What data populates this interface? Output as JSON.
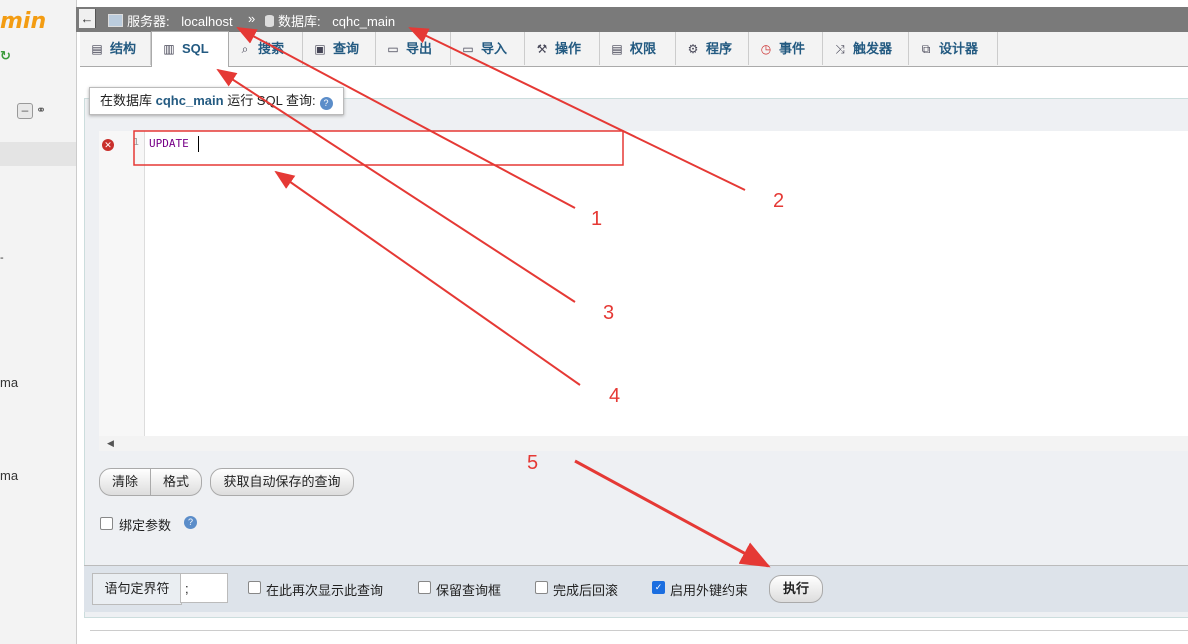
{
  "nav": {
    "logo": "min",
    "partial_items": [
      "ma",
      "ma"
    ]
  },
  "breadcrumb": {
    "server_label": "服务器:",
    "server_value": "localhost",
    "separator": "»",
    "db_label": "数据库:",
    "db_value": "cqhc_main"
  },
  "tabs": [
    {
      "label": "结构",
      "icon": "structure-icon"
    },
    {
      "label": "SQL",
      "icon": "sql-icon",
      "active": true
    },
    {
      "label": "搜索",
      "icon": "search-icon"
    },
    {
      "label": "查询",
      "icon": "query-icon"
    },
    {
      "label": "导出",
      "icon": "export-icon"
    },
    {
      "label": "导入",
      "icon": "import-icon"
    },
    {
      "label": "操作",
      "icon": "wrench-icon"
    },
    {
      "label": "权限",
      "icon": "privileges-icon"
    },
    {
      "label": "程序",
      "icon": "routines-icon"
    },
    {
      "label": "事件",
      "icon": "events-icon"
    },
    {
      "label": "触发器",
      "icon": "triggers-icon"
    },
    {
      "label": "设计器",
      "icon": "designer-icon"
    }
  ],
  "query_title": {
    "prefix": "在数据库",
    "db": "cqhc_main",
    "suffix": "运行 SQL 查询:"
  },
  "editor": {
    "line_number": "1",
    "code": "UPDATE"
  },
  "buttons": {
    "clear": "清除",
    "format": "格式",
    "get_autosaved": "获取自动保存的查询"
  },
  "bind_params": {
    "label": "绑定参数",
    "checked": false
  },
  "footer": {
    "delimiter_label": "语句定界符",
    "delimiter_value": ";",
    "options": [
      {
        "label": "在此再次显示此查询",
        "checked": false
      },
      {
        "label": "保留查询框",
        "checked": false
      },
      {
        "label": "完成后回滚",
        "checked": false
      },
      {
        "label": "启用外键约束",
        "checked": true
      }
    ],
    "execute": "执行"
  },
  "annotations": [
    "1",
    "2",
    "3",
    "4",
    "5"
  ],
  "colors": {
    "annotation": "#e53935",
    "link": "#235a81",
    "breadcrumb_bg": "#7a7a7a"
  }
}
